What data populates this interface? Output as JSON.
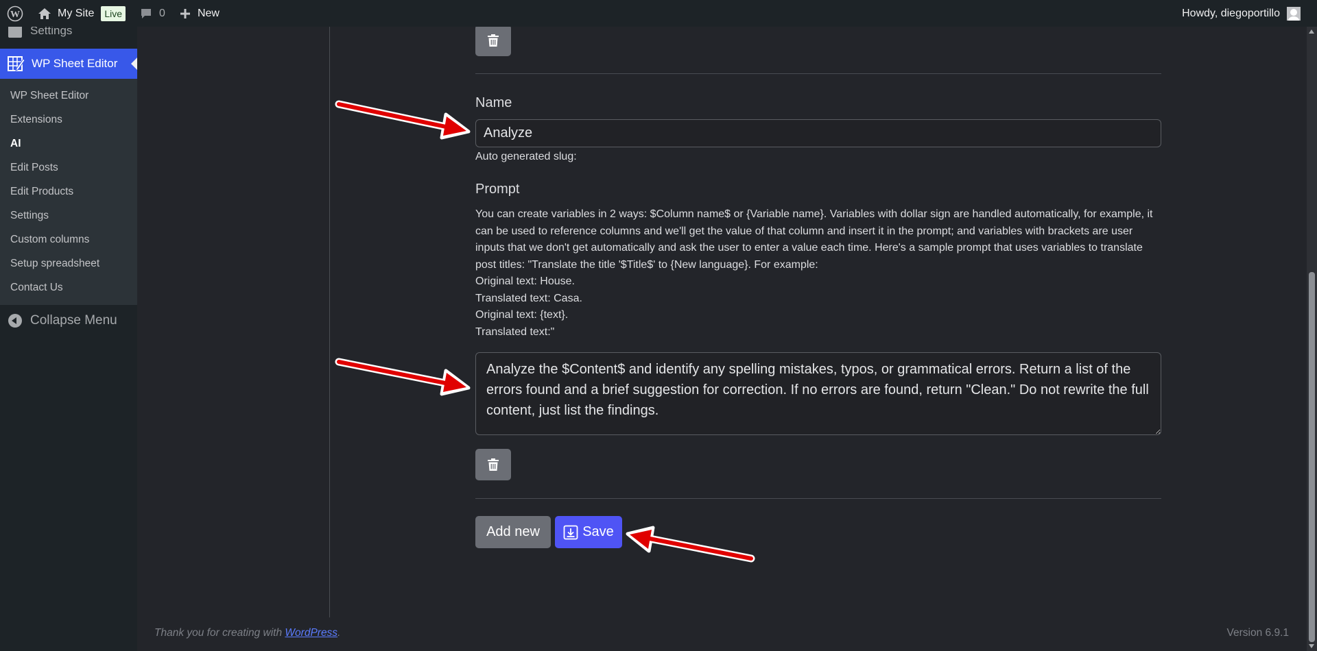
{
  "adminbar": {
    "wp_logo_icon": "wordpress-logo-icon",
    "site_name": "My Site",
    "live_badge": "Live",
    "comments_count": "0",
    "new_label": "New",
    "greeting": "Howdy, diegoportillo"
  },
  "sidebar": {
    "cut_item": "Settings",
    "current_menu": "WP Sheet Editor",
    "submenu": [
      "WP Sheet Editor",
      "Extensions",
      "AI",
      "Edit Posts",
      "Edit Products",
      "Settings",
      "Custom columns",
      "Setup spreadsheet",
      "Contact Us"
    ],
    "active_submenu": "AI",
    "collapse": "Collapse Menu"
  },
  "form": {
    "name_label": "Name",
    "name_value": "Analyze",
    "slug_label": "Auto generated slug:",
    "prompt_label": "Prompt",
    "help_lines": [
      "You can create variables in 2 ways: $Column name$ or {Variable name}. Variables with dollar sign are handled automatically, for example, it can be used to reference columns and we'll get the value of that column and insert it in the prompt; and variables with brackets are user inputs that we don't get automatically and ask the user to enter a value each time. Here's a sample prompt that uses variables to translate post titles: \"Translate the title '$Title$' to {New language}. For example:",
      "Original text: House.",
      "Translated text: Casa.",
      "Original text: {text}.",
      "Translated text:\""
    ],
    "prompt_value": "Analyze the $Content$ and identify any spelling mistakes, typos, or grammatical errors. Return a list of the errors found and a brief suggestion for correction. If no errors are found, return \"Clean.\" Do not rewrite the full content, just list the findings.",
    "add_new": "Add new",
    "save": "Save"
  },
  "footer": {
    "thanks_prefix": "Thank you for creating with ",
    "thanks_link": "WordPress",
    "thanks_suffix": ".",
    "version": "Version 6.9.1"
  },
  "colors": {
    "accent": "#3858e9",
    "save_button": "#4f54f5",
    "annotation_arrow": "#e00000",
    "background": "#23252a"
  }
}
